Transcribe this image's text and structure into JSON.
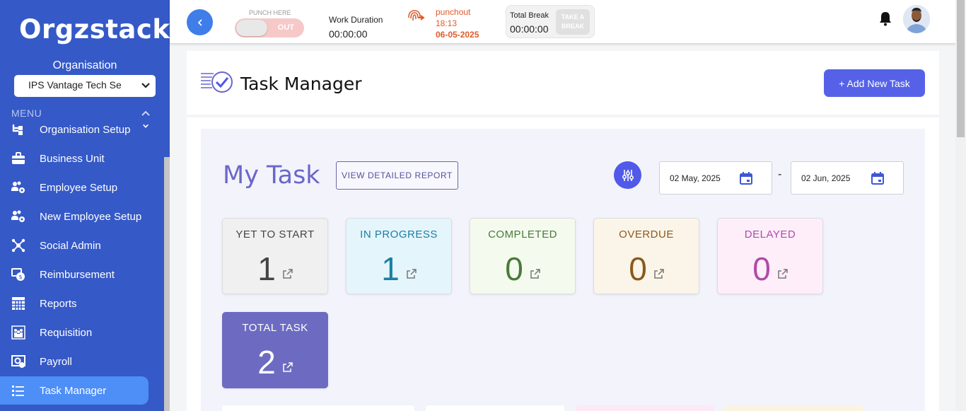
{
  "sidebar": {
    "logo": "Orgzstack",
    "org_label": "Organisation",
    "org_selected": "IPS Vantage Tech Se",
    "menu_header": "MENU",
    "items": [
      {
        "label": "Organisation Setup",
        "icon": "hierarchy-icon"
      },
      {
        "label": "Business Unit",
        "icon": "briefcase-icon"
      },
      {
        "label": "Employee Setup",
        "icon": "users-gear-icon"
      },
      {
        "label": "New Employee Setup",
        "icon": "users-gear-icon"
      },
      {
        "label": "Social Admin",
        "icon": "network-icon"
      },
      {
        "label": "Reimbursement",
        "icon": "money-refresh-icon"
      },
      {
        "label": "Reports",
        "icon": "grid-icon"
      },
      {
        "label": "Requisition",
        "icon": "team-icon"
      },
      {
        "label": "Payroll",
        "icon": "payroll-icon"
      },
      {
        "label": "Task Manager",
        "icon": "task-list-icon"
      }
    ],
    "active_item": "Task Manager"
  },
  "topbar": {
    "punch_label": "PUNCH HERE",
    "punch_state": "OUT",
    "work_duration_label": "Work Duration",
    "work_duration_value": "00:00:00",
    "punch_status": "punchout",
    "punch_time": "18:13",
    "punch_date": "06-05-2025",
    "total_break_label": "Total Break",
    "total_break_value": "00:00:00",
    "take_break_line1": "TAKE A",
    "take_break_line2": "BREAK"
  },
  "header": {
    "title": "Task Manager",
    "add_button": "+ Add New Task"
  },
  "my_task": {
    "title": "My Task",
    "report_button": "VIEW DETAILED REPORT",
    "date_from": "02 May, 2025",
    "date_sep": "-",
    "date_to": "02 Jun, 2025"
  },
  "stats": [
    {
      "label": "YET TO START",
      "value": "1",
      "color": "#444444",
      "bg": "#f0f0f0"
    },
    {
      "label": "IN PROGRESS",
      "value": "1",
      "color": "#1a7fa3",
      "bg": "#e5f5fc"
    },
    {
      "label": "COMPLETED",
      "value": "0",
      "color": "#4a7a3a",
      "bg": "#f4fbee"
    },
    {
      "label": "OVERDUE",
      "value": "0",
      "color": "#8a5a1c",
      "bg": "#fbf5e9"
    },
    {
      "label": "DELAYED",
      "value": "0",
      "color": "#b04aa8",
      "bg": "#fdeefa"
    },
    {
      "label": "TOTAL TASK",
      "value": "2",
      "color": "#ffffff",
      "bg": "#6d6bc1"
    }
  ],
  "colors": {
    "sidebar_bg": "#3559c7",
    "active_item_bg": "#4d8ef7",
    "accent": "#5562e8",
    "punchout_text": "#e05a2b"
  }
}
